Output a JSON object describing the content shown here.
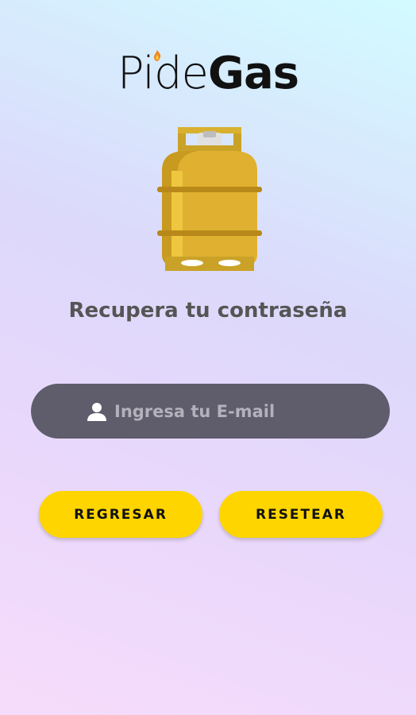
{
  "brand": {
    "part1": "Pide",
    "part2": "Gas"
  },
  "colors": {
    "accent": "#ffd500",
    "field_bg": "#5f5c6c",
    "title": "#555555"
  },
  "illustration": {
    "icon": "gas-cylinder-icon"
  },
  "page": {
    "title": "Recupera tu contraseña"
  },
  "form": {
    "email_placeholder": "Ingresa tu E-mail",
    "email_value": "",
    "icon": "user-icon"
  },
  "buttons": {
    "back_label": "REGRESAR",
    "reset_label": "RESETEAR"
  }
}
